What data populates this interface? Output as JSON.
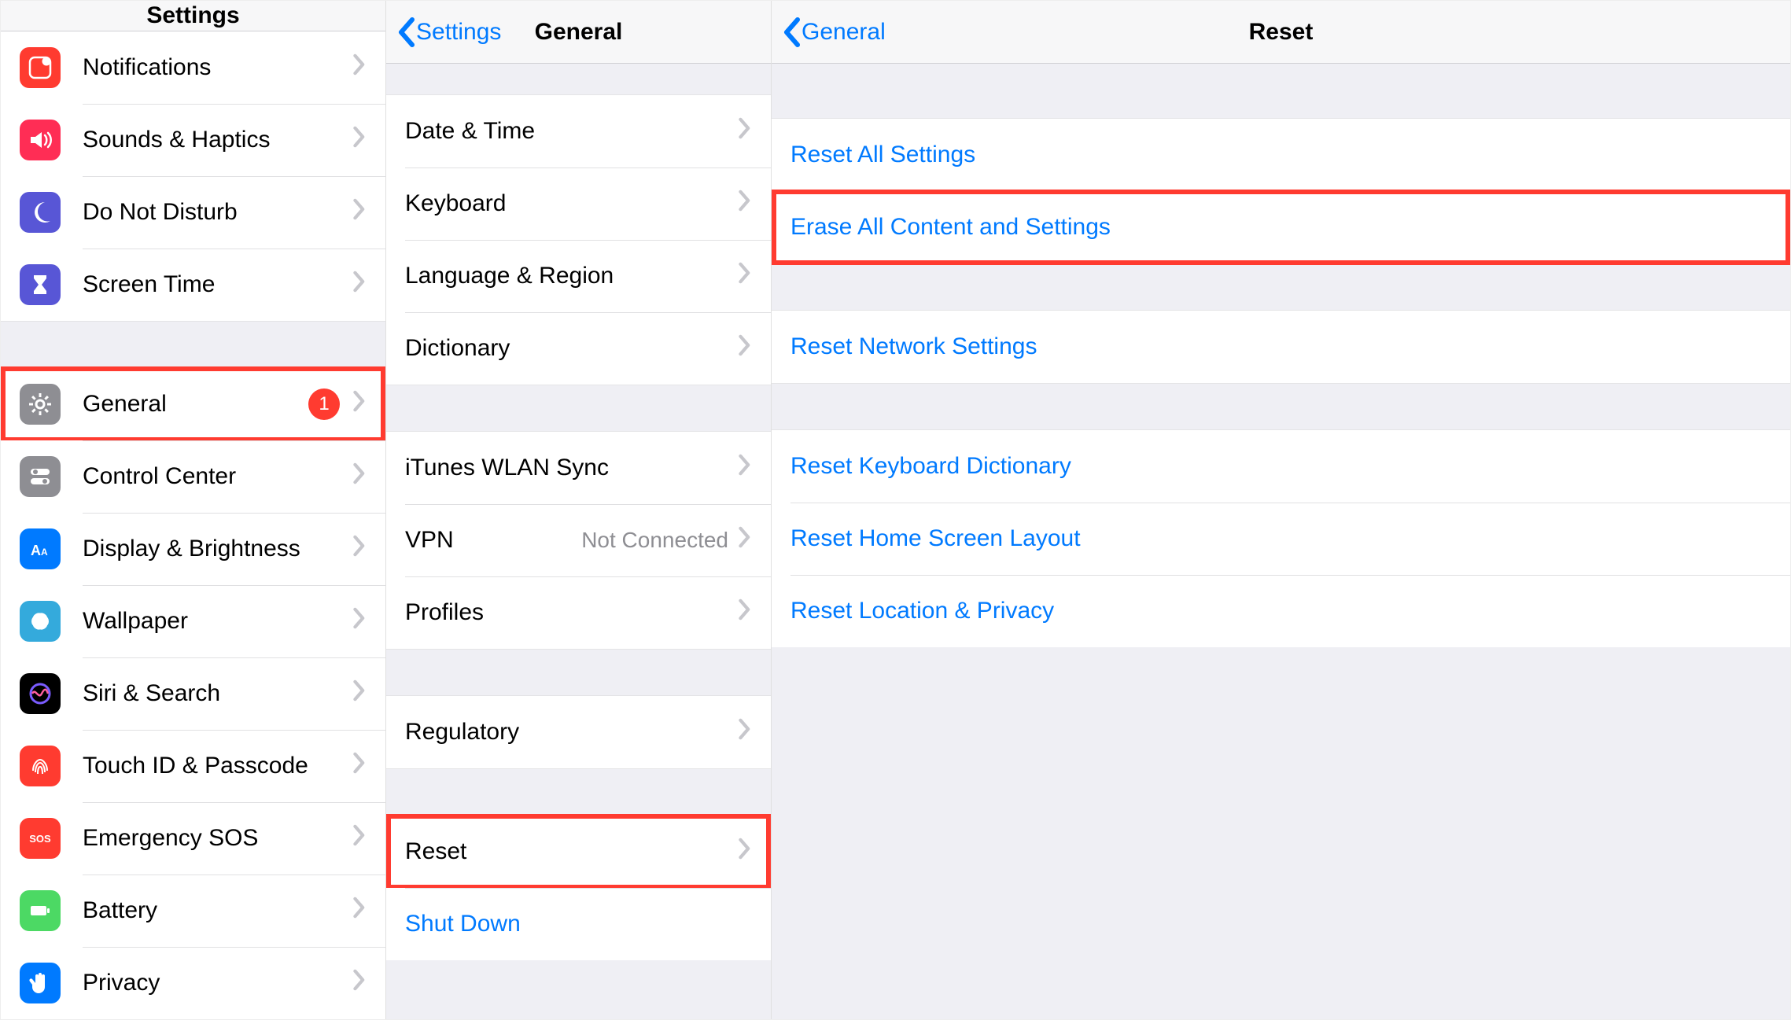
{
  "colors": {
    "link": "#007aff",
    "badge": "#ff3b30",
    "highlight": "#ff3b30"
  },
  "pane1": {
    "title": "Settings",
    "groups": [
      {
        "items": [
          {
            "id": "notifications",
            "label": "Notifications",
            "iconName": "notifications-icon",
            "iconBg": "ic-red"
          },
          {
            "id": "sounds",
            "label": "Sounds & Haptics",
            "iconName": "sounds-icon",
            "iconBg": "ic-pink"
          },
          {
            "id": "dnd",
            "label": "Do Not Disturb",
            "iconName": "moon-icon",
            "iconBg": "ic-purple"
          },
          {
            "id": "screentime",
            "label": "Screen Time",
            "iconName": "hourglass-icon",
            "iconBg": "ic-purple"
          }
        ]
      },
      {
        "items": [
          {
            "id": "general",
            "label": "General",
            "iconName": "gear-icon",
            "iconBg": "ic-gray",
            "badge": "1",
            "highlight": true
          },
          {
            "id": "controlcenter",
            "label": "Control Center",
            "iconName": "switches-icon",
            "iconBg": "ic-gray"
          },
          {
            "id": "display",
            "label": "Display & Brightness",
            "iconName": "text-size-icon",
            "iconBg": "ic-blue"
          },
          {
            "id": "wallpaper",
            "label": "Wallpaper",
            "iconName": "flower-icon",
            "iconBg": "ic-cyan"
          },
          {
            "id": "siri",
            "label": "Siri & Search",
            "iconName": "siri-icon",
            "iconBg": "ic-black"
          },
          {
            "id": "touchid",
            "label": "Touch ID & Passcode",
            "iconName": "fingerprint-icon",
            "iconBg": "ic-red"
          },
          {
            "id": "sos",
            "label": "Emergency SOS",
            "iconName": "sos-icon",
            "iconBg": "ic-red",
            "iconText": "SOS"
          },
          {
            "id": "battery",
            "label": "Battery",
            "iconName": "battery-icon",
            "iconBg": "ic-green"
          },
          {
            "id": "privacy",
            "label": "Privacy",
            "iconName": "hand-icon",
            "iconBg": "ic-blue"
          }
        ]
      }
    ]
  },
  "pane2": {
    "backLabel": "Settings",
    "title": "General",
    "groups": [
      {
        "leading": true,
        "items": [
          {
            "id": "datetime",
            "label": "Date & Time"
          },
          {
            "id": "keyboard",
            "label": "Keyboard"
          },
          {
            "id": "langregion",
            "label": "Language & Region"
          },
          {
            "id": "dictionary",
            "label": "Dictionary"
          }
        ]
      },
      {
        "items": [
          {
            "id": "itunes",
            "label": "iTunes WLAN Sync"
          },
          {
            "id": "vpn",
            "label": "VPN",
            "detail": "Not Connected"
          },
          {
            "id": "profiles",
            "label": "Profiles"
          }
        ]
      },
      {
        "items": [
          {
            "id": "regulatory",
            "label": "Regulatory"
          }
        ]
      },
      {
        "items": [
          {
            "id": "reset",
            "label": "Reset",
            "highlight": true
          },
          {
            "id": "shutdown",
            "label": "Shut Down",
            "blue": true,
            "noChevron": true
          }
        ]
      }
    ]
  },
  "pane3": {
    "backLabel": "General",
    "title": "Reset",
    "groups": [
      {
        "leading": true,
        "items": [
          {
            "id": "resetall",
            "label": "Reset All Settings",
            "blue": true,
            "noChevron": true
          },
          {
            "id": "eraseall",
            "label": "Erase All Content and Settings",
            "blue": true,
            "noChevron": true,
            "highlight": true
          }
        ]
      },
      {
        "items": [
          {
            "id": "resetnet",
            "label": "Reset Network Settings",
            "blue": true,
            "noChevron": true
          }
        ]
      },
      {
        "items": [
          {
            "id": "resetkbd",
            "label": "Reset Keyboard Dictionary",
            "blue": true,
            "noChevron": true
          },
          {
            "id": "resethome",
            "label": "Reset Home Screen Layout",
            "blue": true,
            "noChevron": true
          },
          {
            "id": "resetloc",
            "label": "Reset Location & Privacy",
            "blue": true,
            "noChevron": true
          }
        ]
      }
    ]
  }
}
